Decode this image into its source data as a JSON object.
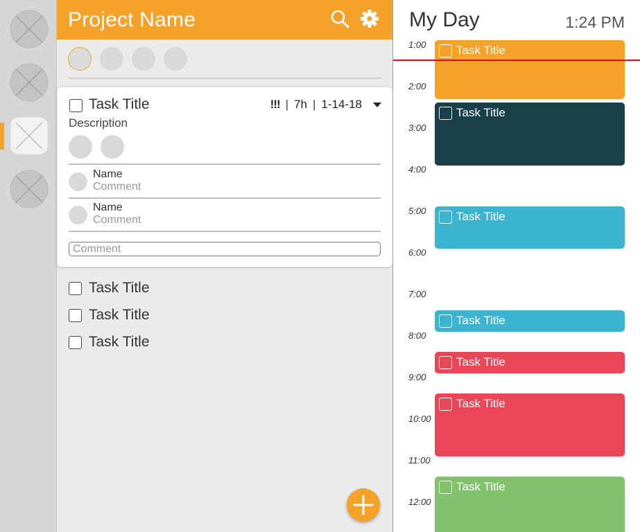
{
  "rail": {
    "items": [
      {
        "name": "project-1",
        "active": false
      },
      {
        "name": "project-2",
        "active": false
      },
      {
        "name": "project-3",
        "active": true
      },
      {
        "name": "project-4",
        "active": false
      }
    ]
  },
  "project": {
    "title": "Project Name",
    "search_icon": "search-icon",
    "settings_icon": "gear-icon",
    "members": [
      "member-1",
      "member-2",
      "member-3",
      "member-4"
    ]
  },
  "expanded_task": {
    "title": "Task Title",
    "priority": "!!!",
    "estimate": "7h",
    "due": "1-14-18",
    "description": "Description",
    "comments": [
      {
        "name": "Name",
        "text": "Comment"
      },
      {
        "name": "Name",
        "text": "Comment"
      }
    ],
    "comment_placeholder": "Comment"
  },
  "tasks": [
    {
      "title": "Task Title"
    },
    {
      "title": "Task Title"
    },
    {
      "title": "Task Title"
    }
  ],
  "add_button_icon": "plus-icon",
  "my_day": {
    "title": "My Day",
    "current_time": "1:24 PM",
    "hours": [
      "1:00",
      "2:00",
      "3:00",
      "4:00",
      "5:00",
      "6:00",
      "7:00",
      "8:00",
      "9:00",
      "10:00",
      "11:00",
      "12:00"
    ],
    "events": [
      {
        "title": "Task Title",
        "color": "#f5a22a"
      },
      {
        "title": "Task Title",
        "color": "#193f4b"
      },
      {
        "title": "Task Title",
        "color": "#3cb4cf"
      },
      {
        "title": "Task Title",
        "color": "#3cb4cf"
      },
      {
        "title": "Task Title",
        "color": "#e94757"
      },
      {
        "title": "Task Title",
        "color": "#e94757"
      },
      {
        "title": "Task Title",
        "color": "#82c26d"
      }
    ]
  },
  "colors": {
    "accent": "#f5a22a",
    "now_line": "#d0111b"
  }
}
